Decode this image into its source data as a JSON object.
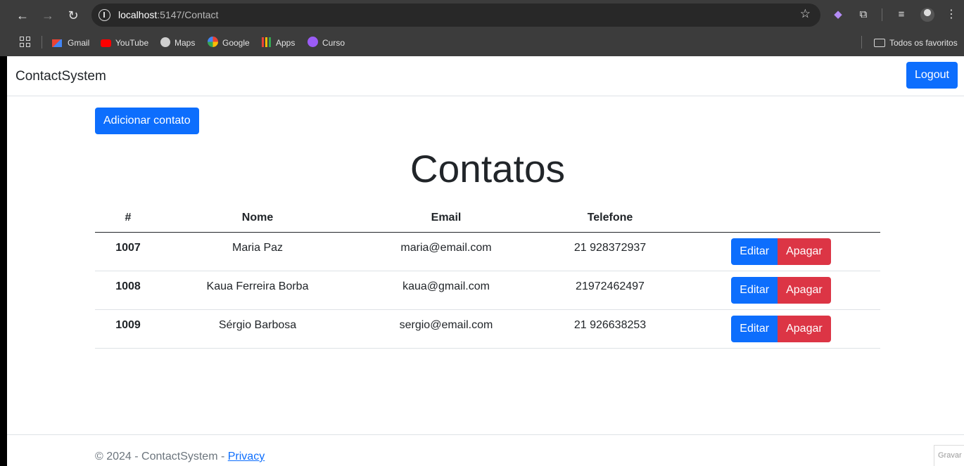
{
  "browser": {
    "url_host": "localhost",
    "url_path": ":5147/Contact",
    "bookmarks": [
      {
        "label": "Gmail",
        "icon": "gmail-icon"
      },
      {
        "label": "YouTube",
        "icon": "youtube-icon"
      },
      {
        "label": "Maps",
        "icon": "maps-icon"
      },
      {
        "label": "Google",
        "icon": "google-icon"
      },
      {
        "label": "Apps",
        "icon": "apps-icon"
      },
      {
        "label": "Curso",
        "icon": "curso-icon"
      }
    ],
    "all_bookmarks": "Todos os favoritos"
  },
  "navbar": {
    "brand": "ContactSystem",
    "logout_label": "Logout"
  },
  "main": {
    "add_label": "Adicionar contato",
    "title": "Contatos",
    "table": {
      "headers": [
        "#",
        "Nome",
        "Email",
        "Telefone",
        ""
      ],
      "rows": [
        {
          "id": "1007",
          "name": "Maria Paz",
          "email": "maria@email.com",
          "phone": "21 928372937"
        },
        {
          "id": "1008",
          "name": "Kaua Ferreira Borba",
          "email": "kaua@gmail.com",
          "phone": "21972462497"
        },
        {
          "id": "1009",
          "name": "Sérgio Barbosa",
          "email": "sergio@email.com",
          "phone": "21 926638253"
        }
      ],
      "edit_label": "Editar",
      "delete_label": "Apagar"
    }
  },
  "footer": {
    "text": "© 2024 - ContactSystem - ",
    "privacy_label": "Privacy",
    "gravar_label": "Gravar"
  },
  "colors": {
    "primary": "#0d6efd",
    "danger": "#dc3545",
    "chrome_bg": "#3c3c3c"
  }
}
